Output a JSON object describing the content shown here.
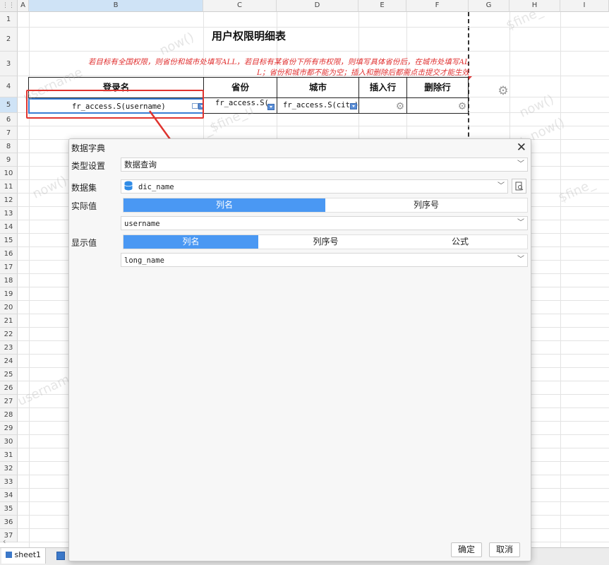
{
  "spreadsheet": {
    "columns": [
      "A",
      "B",
      "C",
      "D",
      "E",
      "F",
      "G",
      "H",
      "I"
    ],
    "rows": [
      "1",
      "2",
      "3",
      "4",
      "5",
      "6",
      "7",
      "8",
      "9",
      "10",
      "11",
      "12",
      "13",
      "14",
      "15",
      "16",
      "17",
      "18",
      "19",
      "20",
      "21",
      "22",
      "23",
      "24",
      "25",
      "26",
      "27",
      "28",
      "29",
      "30",
      "31",
      "32",
      "33",
      "34",
      "35",
      "36",
      "37"
    ],
    "title": "用户权限明细表",
    "note_line1": "若目标有全国权限，则省份和城市处填写ALL，若目标有某省份下所有市权限，则填写具体省份后，在城市处填写AL",
    "note_line2": "L；省份和城市都不能为空；插入和删除后都需点击提交才能生效",
    "headers": [
      "登录名",
      "省份",
      "城市",
      "插入行",
      "删除行"
    ],
    "cells": {
      "login": "fr_access.S(username)",
      "province": "fr_access.S(",
      "city": "fr_access.S(city)"
    },
    "watermarks": [
      "now()",
      "$fine_",
      "username",
      "now()",
      "_$fine_u",
      "sername + now()",
      "$fine_",
      "username",
      "now()"
    ],
    "sheet_tab": "sheet1"
  },
  "dialog": {
    "title": "数据字典",
    "type_label": "类型设置",
    "type_value": "数据查询",
    "dataset_label": "数据集",
    "dataset_value": "dic_name",
    "actual_label": "实际值",
    "actual_tabs": [
      "列名",
      "列序号"
    ],
    "actual_value": "username",
    "display_label": "显示值",
    "display_tabs": [
      "列名",
      "列序号",
      "公式"
    ],
    "display_value": "long_name",
    "ok": "确定",
    "cancel": "取消"
  },
  "colors": {
    "accent": "#4a98f3",
    "annotation": "#e0342f",
    "note": "#e03030"
  }
}
